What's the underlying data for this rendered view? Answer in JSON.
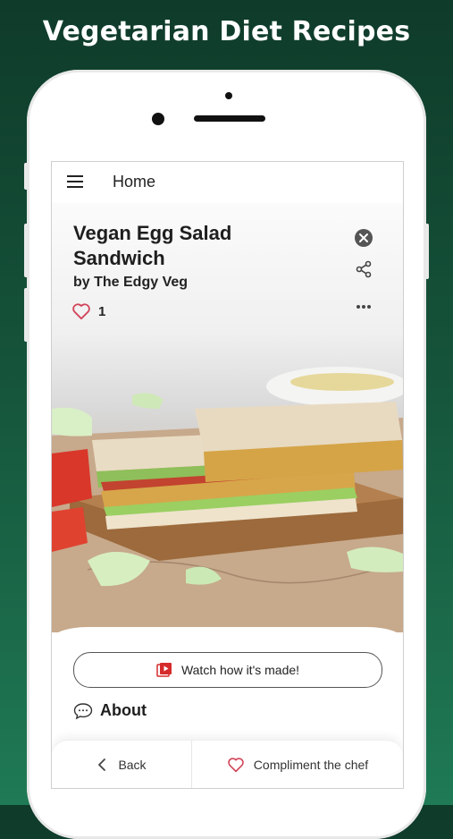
{
  "banner": {
    "title": "Vegetarian Diet Recipes"
  },
  "appbar": {
    "title": "Home"
  },
  "recipe": {
    "title": "Vegan Egg Salad Sandwich",
    "author": "by The Edgy Veg",
    "likes": "1"
  },
  "actions": {
    "watch_label": "Watch how it's made!",
    "about_label": "About"
  },
  "bottom_bar": {
    "back_label": "Back",
    "compliment_label": "Compliment the chef"
  },
  "colors": {
    "background": "#15533a",
    "heart": "#d2465a",
    "video_icon": "#d62b2b"
  },
  "icons": [
    "menu-icon",
    "close-icon",
    "share-icon",
    "more-icon",
    "heart-icon",
    "video-icon",
    "chat-bubble-icon",
    "chevron-left-icon"
  ]
}
